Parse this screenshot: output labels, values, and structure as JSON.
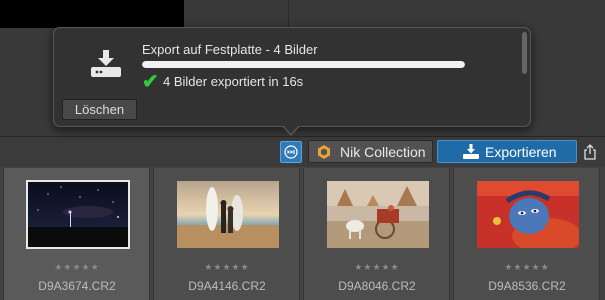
{
  "export_popup": {
    "title": "Export auf Festplatte - 4 Bilder",
    "progress": 1.0,
    "status": "4 Bilder exportiert in 16s",
    "clear_button": "Löschen"
  },
  "toolbar": {
    "nik_label": "Nik Collection",
    "export_label": "Exportieren"
  },
  "filmstrip": {
    "items": [
      {
        "filename": "D9A3674.CR2",
        "rating": "★★★★★"
      },
      {
        "filename": "D9A4146.CR2",
        "rating": "★★★★★"
      },
      {
        "filename": "D9A8046.CR2",
        "rating": "★★★★★"
      },
      {
        "filename": "D9A8536.CR2",
        "rating": "★★★★★"
      }
    ]
  },
  "colors": {
    "accent": "#1f6ba8",
    "check": "#37c83a"
  }
}
